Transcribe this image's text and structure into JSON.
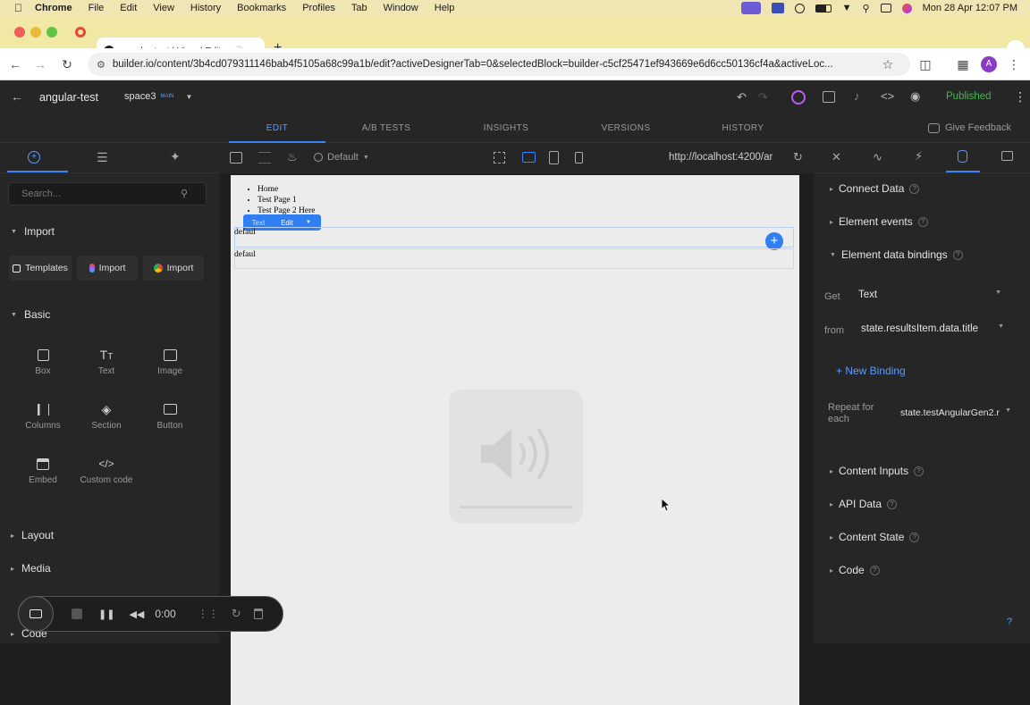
{
  "menubar": {
    "app": "Chrome",
    "items": [
      "File",
      "Edit",
      "View",
      "History",
      "Bookmarks",
      "Profiles",
      "Tab",
      "Window",
      "Help"
    ],
    "clock": "Mon 28 Apr  12:07 PM"
  },
  "browser": {
    "tab_title": "angular-test | Visual Edit",
    "url": "builder.io/content/3b4cd079311146bab4f5105a68c99a1b/edit?activeDesignerTab=0&selectedBlock=builder-c5cf25471ef943669e6d6cc50136cf4a&activeLoc...",
    "profile_initial": "A"
  },
  "topbar": {
    "project": "angular-test",
    "space": "space3",
    "space_badge": "MAIN",
    "status": "Published"
  },
  "content_tabs": [
    "EDIT",
    "A/B TESTS",
    "INSIGHTS",
    "VERSIONS",
    "HISTORY"
  ],
  "feedback_label": "Give Feedback",
  "left_panel": {
    "search_placeholder": "Search...",
    "import_section": "Import",
    "import_buttons": [
      "Templates",
      "Import",
      "Import"
    ],
    "basic_section": "Basic",
    "blocks": [
      "Box",
      "Text",
      "Image",
      "Columns",
      "Section",
      "Button",
      "Embed",
      "Custom code"
    ],
    "layout_section": "Layout",
    "media_section": "Media",
    "code_section": "Code"
  },
  "canvas_bar": {
    "breakpoint": "Default",
    "preview_url": "http://localhost:4200/ar"
  },
  "canvas": {
    "nav_items": [
      "Home",
      "Test Page 1",
      "Test Page 2 Here"
    ],
    "edit_pill": {
      "type": "Text",
      "action": "Edit"
    },
    "default_text_1": "defaul",
    "default_text_2": "defaul"
  },
  "right_panel": {
    "connect_data": "Connect Data",
    "element_events": "Element events",
    "element_data_bindings": "Element data bindings",
    "get_label": "Get",
    "get_value": "Text",
    "from_label": "from",
    "from_value": "state.resultsItem.data.title",
    "new_binding": "+ New Binding",
    "repeat_label": "Repeat for each",
    "repeat_value": "state.testAngularGen2.r",
    "content_inputs": "Content Inputs",
    "api_data": "API Data",
    "content_state": "Content State",
    "code": "Code"
  },
  "recorder": {
    "time": "0:00"
  },
  "colors": {
    "accent": "#3b82f6",
    "published": "#3fb950",
    "panel": "#262626",
    "canvas": "#ececec"
  }
}
